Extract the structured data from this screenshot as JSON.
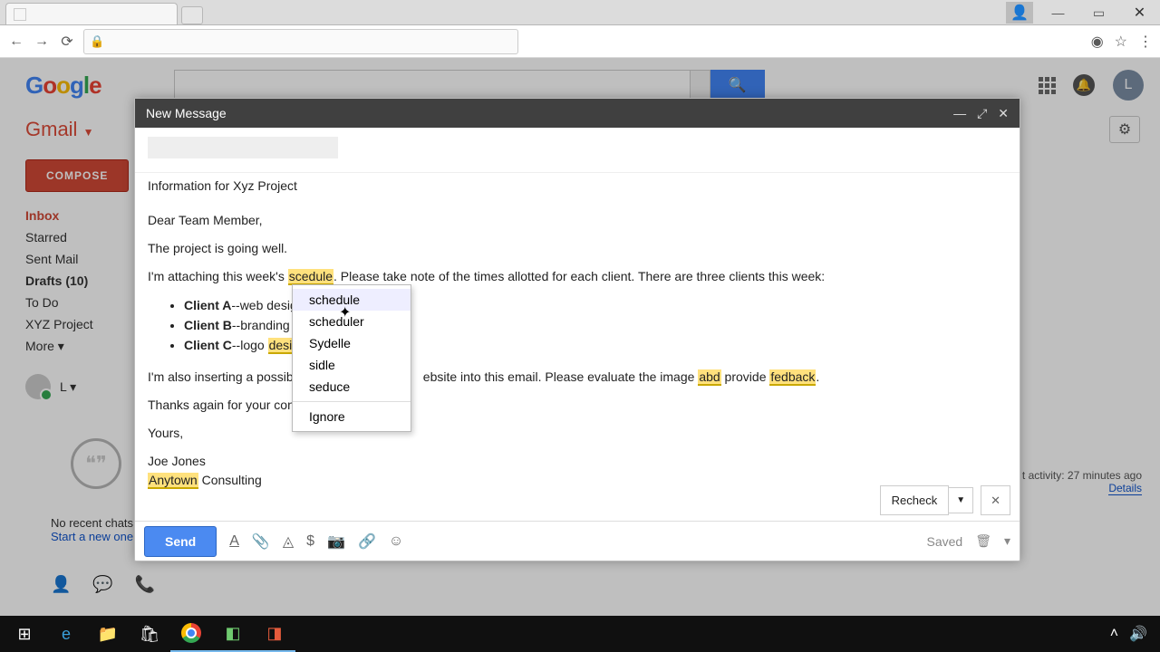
{
  "browser": {
    "win_min": "—",
    "win_max": "▭",
    "win_close": "✕",
    "nav_back": "←",
    "nav_fwd": "→",
    "nav_reload": "⟳",
    "lock": "🔒",
    "star": "☆",
    "eye": "◉",
    "menu": "⋮"
  },
  "google": {
    "apps": "Apps",
    "bell": "🔔",
    "avatar": "L",
    "search_icon": "🔍"
  },
  "gmail": {
    "logo": "Gmail ",
    "caret": "▼",
    "compose": "COMPOSE",
    "gear": "⚙",
    "sidebar": {
      "inbox": "Inbox",
      "starred": "Starred",
      "sent": "Sent Mail",
      "drafts": "Drafts (10)",
      "todo": "To Do",
      "xyz": "XYZ Project",
      "more": "More ▾"
    },
    "user": "L ▾",
    "chat_empty": "No recent chats",
    "chat_start": "Start a new one",
    "hangouts": "❝❞",
    "bottom_person": "👤",
    "bottom_hangouts": "💬",
    "bottom_phone": "📞"
  },
  "activity": {
    "line": "t activity: 27 minutes ago",
    "details": "Details"
  },
  "compose": {
    "title": "New Message",
    "min": "—",
    "pop": "⤢",
    "close": "✕",
    "subject": "Information for Xyz Project",
    "body": {
      "greet": "Dear Team Member,",
      "p1": "The project is going well.",
      "p2a": "I'm attaching this week's ",
      "misspell1": "scedule",
      "p2b": ". Please take note of the times allotted for each client. There are three clients this week:",
      "li1a": "Client A",
      "li1b": "--web design",
      "li2a": "Client B",
      "li2b": "--branding",
      "li3a": "Client C",
      "li3b": "--logo ",
      "misspell2": "desin",
      "p3a": "I'm also inserting a possible ",
      "p3gap": "                                 ",
      "p3b": "ebsite into this email. Please evaluate the image ",
      "misspell3": "abd",
      "p3c": " provide ",
      "misspell4": "fedback",
      "p3d": ".",
      "p4": "Thanks again for your contrib",
      "p5": "Yours,",
      "sig1": "Joe Jones",
      "sig2a": "Anytown",
      "sig2b": " Consulting"
    },
    "recheck": "Recheck",
    "recheck_dd": "▼",
    "recheck_x": "✕",
    "send": "Send",
    "saved": "Saved",
    "trash": "🗑",
    "more": "▾",
    "fmt_A": "A",
    "fmt_attach": "📎",
    "fmt_drive": "◬",
    "fmt_money": "$",
    "fmt_photo": "📷",
    "fmt_link": "🔗",
    "fmt_emoji": "☺"
  },
  "spellmenu": {
    "o1": "schedule",
    "o2": "scheduler",
    "o3": "Sydelle",
    "o4": "sidle",
    "o5": "seduce",
    "ignore": "Ignore"
  },
  "taskbar": {
    "start": "⊞",
    "edge": "e",
    "files": "📁",
    "store": "🛍",
    "chrome": "◉",
    "app1": "◧",
    "app2": "◨",
    "tray_up": "˄",
    "tray_vol": "🔊"
  }
}
